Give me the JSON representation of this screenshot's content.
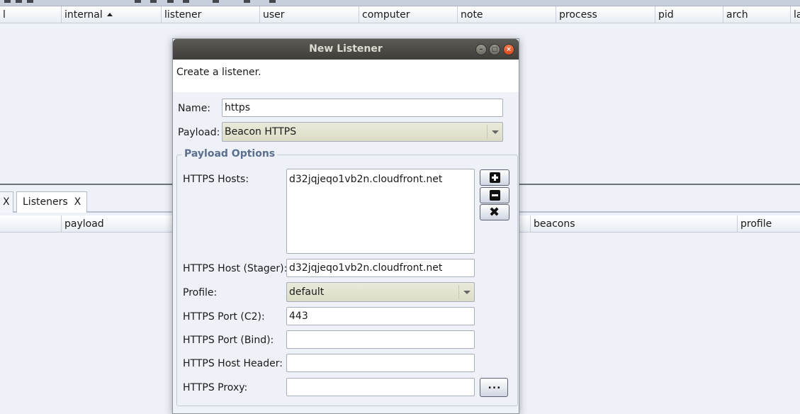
{
  "top_table": {
    "columns": [
      "l",
      "internal",
      "listener",
      "user",
      "computer",
      "note",
      "process",
      "pid",
      "arch",
      "la"
    ]
  },
  "tabs": [
    {
      "label": "",
      "close": "X"
    },
    {
      "label": "Listeners",
      "close": "X"
    }
  ],
  "bottom_table": {
    "columns": [
      "payload",
      "beacons",
      "profile"
    ]
  },
  "dialog": {
    "title": "New Listener",
    "window_buttons": {
      "minimize": "–",
      "maximize": "□",
      "close": "×"
    },
    "description": "Create a listener.",
    "name_label": "Name:",
    "name_value": "https",
    "payload_label": "Payload:",
    "payload_value": "Beacon HTTPS",
    "options_legend": "Payload Options",
    "hosts_label": "HTTPS Hosts:",
    "hosts": [
      "d32jqjeqo1vb2n.cloudfront.net"
    ],
    "host_stager_label": "HTTPS Host (Stager):",
    "host_stager_value": "d32jqjeqo1vb2n.cloudfront.net",
    "profile_label": "Profile:",
    "profile_value": "default",
    "port_c2_label": "HTTPS Port (C2):",
    "port_c2_value": "443",
    "port_bind_label": "HTTPS Port (Bind):",
    "port_bind_value": "",
    "host_header_label": "HTTPS Host Header:",
    "host_header_value": "",
    "proxy_label": "HTTPS Proxy:",
    "proxy_value": "",
    "proxy_button": "...",
    "remove_glyph": "✖"
  },
  "colors": {
    "background": "#eef1f8",
    "titlebar": "#4a4844",
    "close_button": "#e05a2f",
    "legend": "#5b6f8e"
  }
}
